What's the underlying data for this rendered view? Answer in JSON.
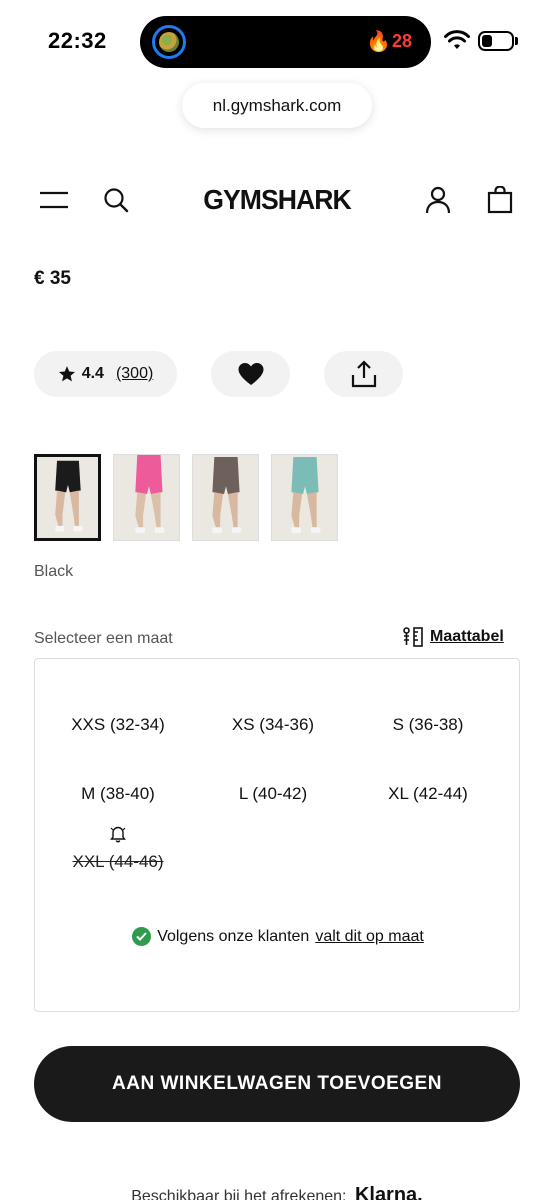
{
  "status_bar": {
    "time": "22:32",
    "activity_count": "28",
    "activity_icon": "fire-icon"
  },
  "browser": {
    "url": "nl.gymshark.com"
  },
  "header": {
    "logo": "GYMSHARK",
    "icons": [
      "menu-icon",
      "search-icon",
      "account-icon",
      "bag-icon"
    ]
  },
  "product": {
    "price": "€ 35",
    "rating": "4.4",
    "review_count": "(300)",
    "selected_color": "Black",
    "swatches": [
      {
        "color_name": "Black",
        "hex": "#1b1b1b",
        "selected": true
      },
      {
        "color_name": "Pink",
        "hex": "#ee5b9a",
        "selected": false
      },
      {
        "color_name": "Brown",
        "hex": "#6e605a",
        "selected": false
      },
      {
        "color_name": "Teal",
        "hex": "#7bbcb6",
        "selected": false
      }
    ]
  },
  "size_selector": {
    "label": "Selecteer een maat",
    "size_chart_label": "Maattabel",
    "sizes": [
      {
        "label": "XXS (32-34)",
        "available": true
      },
      {
        "label": "XS (34-36)",
        "available": true
      },
      {
        "label": "S (36-38)",
        "available": true
      },
      {
        "label": "M (38-40)",
        "available": true
      },
      {
        "label": "L (40-42)",
        "available": true
      },
      {
        "label": "XL (42-44)",
        "available": true
      },
      {
        "label": "XXL (44-46)",
        "available": false
      }
    ],
    "fit_note_prefix": "Volgens onze klanten",
    "fit_note_link": "valt dit op maat"
  },
  "cta": {
    "add_to_cart": "AAN WINKELWAGEN TOEVOEGEN"
  },
  "payment": {
    "text": "Beschikbaar bij het afrekenen:",
    "provider": "Klarna."
  },
  "colors": {
    "cta_bg": "#1a1a1a",
    "pill_bg": "#f2f2f2",
    "success": "#2e9b4f",
    "alert": "#ff3b30"
  }
}
